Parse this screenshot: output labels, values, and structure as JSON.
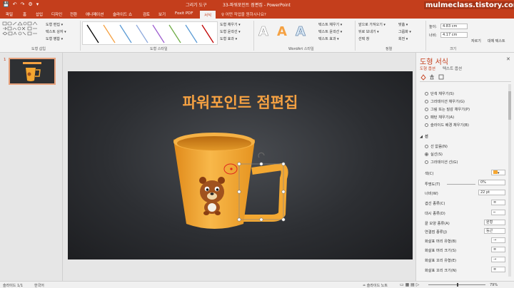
{
  "titlebar": {
    "context_tab": "그리기 도구",
    "title": "33-파워포인트 점편집 - PowerPoint",
    "qat": [
      "💾",
      "↶",
      "↷",
      "⚙",
      "▾"
    ]
  },
  "watermark": "mulmeclass.tistory.com",
  "tabs": [
    "파일",
    "홈",
    "삽입",
    "디자인",
    "전환",
    "애니메이션",
    "슬라이드 쇼",
    "검토",
    "보기",
    "Foxit PDF",
    "서식"
  ],
  "active_tab": "서식",
  "tellme": "♀ 어떤 작업을 원하시나요?",
  "ribbon": {
    "groups": {
      "insert_shapes": "도형 삽입",
      "shape_styles": "도형 스타일",
      "wordart": "WordArt 스타일",
      "arrange": "정렬",
      "size": "크기"
    },
    "edit_shape": "도형 편집 ▾",
    "text_box": "텍스트 상자 ▾",
    "merge_shapes": "도형 병합 ▾",
    "shape_fill": "도형 채우기 ▾",
    "shape_outline": "도형 윤곽선 ▾",
    "shape_effects": "도형 효과 ▾",
    "text_fill": "텍스트 채우기 ▾",
    "text_outline": "텍스트 윤곽선 ▾",
    "text_effects": "텍스트 효과 ▾",
    "bring_forward": "앞으로 가져오기 ▾",
    "send_backward": "뒤로 보내기 ▾",
    "selection_pane": "선택 창",
    "align": "맞춤 ▾",
    "group": "그룹화 ▾",
    "rotate": "회전 ▾",
    "height_label": "높이:",
    "height_value": "4.83 cm",
    "width_label": "너비:",
    "width_value": "4.17 cm",
    "crop": "자르기",
    "alt_text": "대체 텍스트",
    "wordart_letter": "A",
    "line_colors": [
      "#000000",
      "#f5a142",
      "#5b9bd5",
      "#8faadc",
      "#9e5ecf",
      "#70ad47",
      "#5b9bd5",
      "#c00000"
    ]
  },
  "thumbnail": {
    "number": "1"
  },
  "slide": {
    "title": "파워포인트 점편집"
  },
  "format_pane": {
    "title": "도형 서식",
    "close": "✕",
    "tab_shape": "도형 옵션",
    "tab_text": "텍스트 옵션",
    "fill_options": [
      "단색 채우기(S)",
      "그라데이션 채우기(G)",
      "그림 또는 질감 채우기(P)",
      "패턴 채우기(A)",
      "슬라이드 배경 채우기(B)"
    ],
    "line_section": "선",
    "line_options": [
      "선 없음(N)",
      "실선(S)",
      "그라데이션 선(G)"
    ],
    "line_selected": 1,
    "props": [
      {
        "label": "색(C)",
        "value": ""
      },
      {
        "label": "투명도(T)",
        "value": "0%"
      },
      {
        "label": "너비(W)",
        "value": "22 pt"
      },
      {
        "label": "겹선 종류(C)",
        "value": ""
      },
      {
        "label": "대시 종류(D)",
        "value": ""
      },
      {
        "label": "끝 모양 종류(A)",
        "value": "원형"
      },
      {
        "label": "연결점 종류(J)",
        "value": "둥근"
      },
      {
        "label": "화살표 머리 유형(B)",
        "value": ""
      },
      {
        "label": "화살표 머리 크기(S)",
        "value": ""
      },
      {
        "label": "화살표 꼬리 유형(E)",
        "value": ""
      },
      {
        "label": "화살표 꼬리 크기(N)",
        "value": ""
      }
    ]
  },
  "status": {
    "slide_info": "슬라이드 1/1",
    "language": "한국어",
    "notes": "≐ 슬라이드 노트",
    "zoom": "79%"
  },
  "colors": {
    "brand": "#c43e1c",
    "mug": "#f5a630",
    "title": "#f5a142"
  }
}
